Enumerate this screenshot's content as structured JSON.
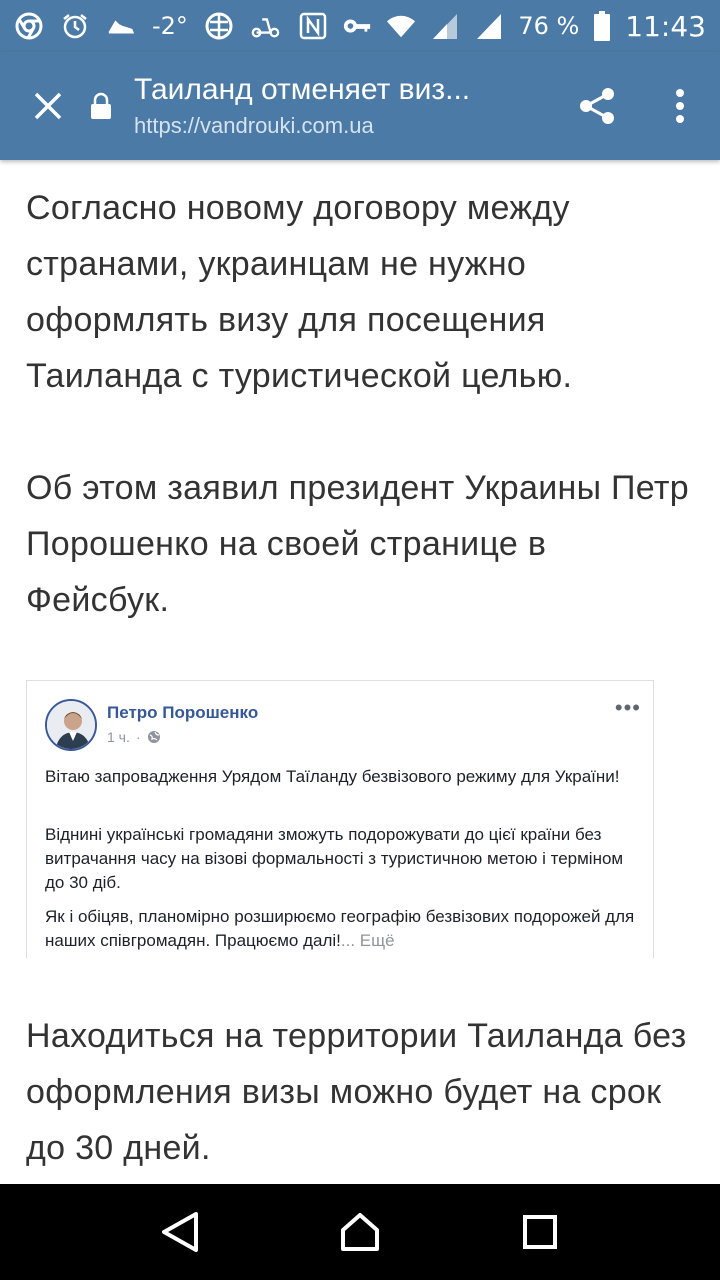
{
  "status_bar": {
    "temperature": "-2°",
    "battery": "76 %",
    "time": "11:43",
    "icons": [
      "chrome-icon",
      "alarm-icon",
      "shoe-icon",
      "weather-icon",
      "vpn-globe-icon",
      "scooter-icon",
      "nfc-icon",
      "key-icon",
      "wifi-icon",
      "signal-icon",
      "signal-icon",
      "battery-icon"
    ]
  },
  "toolbar": {
    "title": "Таиланд отменяет виз...",
    "url": "https://vandrouki.com.ua",
    "close_icon": "close-icon",
    "lock_icon": "lock-icon",
    "share_icon": "share-icon",
    "more_icon": "more-vert-icon"
  },
  "article": {
    "paragraph1": "Согласно новому договору между странами, украинцам не нужно оформлять визу для посещения Таиланда с туристической целью.",
    "paragraph2": "Об этом заявил президент Украины Петр Порошенко на своей странице в Фейсбук.",
    "paragraph3": "Находиться на территории Таиланда без оформления визы можно будет на срок до 30 дней."
  },
  "fb_post": {
    "author": "Петро Порошенко",
    "time": "1 ч.",
    "more": "•••",
    "text1": "Вітаю запровадження Урядом Таїланду безвізового режиму для України!",
    "text2": "Віднині українські громадяни зможуть подорожувати до цієї країни без витрачання часу на візові формальності з туристичною метою і терміном до 30 діб.",
    "text3": "Як і обіцяв, планомірно розширюємо географію безвізових подорожей для наших співгромадян. Працюємо далі!",
    "see_more": "... Ещё"
  },
  "colors": {
    "toolbar": "#4a7aa5",
    "text": "#333333",
    "fb_blue": "#365899"
  }
}
